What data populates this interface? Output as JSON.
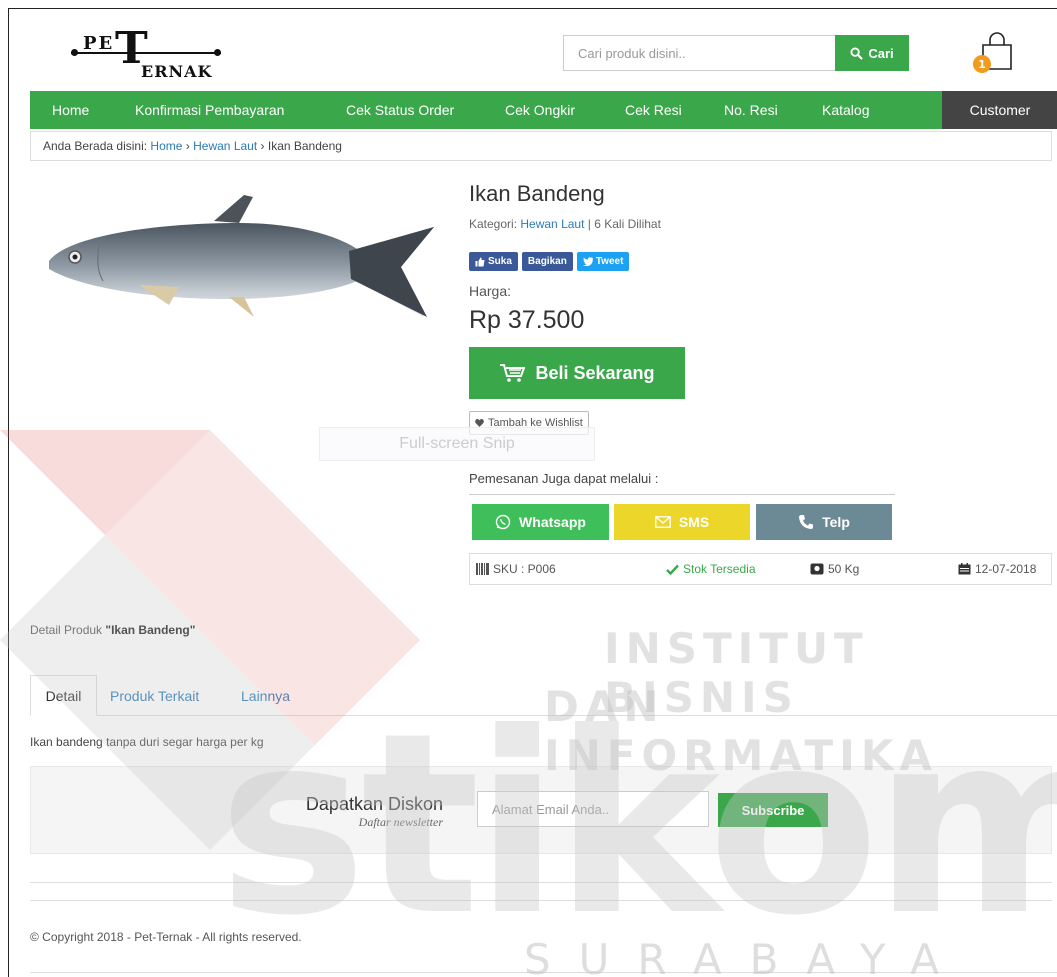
{
  "header": {
    "logo_top": "PE",
    "logo_bottom": "ERNAK",
    "search_placeholder": "Cari produk disini..",
    "search_button": "Cari",
    "cart_count": "1"
  },
  "nav": {
    "items": [
      "Home",
      "Konfirmasi Pembayaran",
      "Cek Status Order",
      "Cek Ongkir",
      "Cek Resi",
      "No. Resi",
      "Katalog"
    ],
    "customer": "Customer"
  },
  "breadcrumb": {
    "prefix": "Anda Berada disini:",
    "home": "Home",
    "sep1": "›",
    "category": "Hewan Laut",
    "sep2": "›",
    "current": "Ikan Bandeng"
  },
  "product": {
    "title": "Ikan Bandeng",
    "category_label": "Kategori:",
    "category": "Hewan Laut",
    "views": "| 6 Kali Dilihat",
    "social": {
      "like": "Suka",
      "share": "Bagikan",
      "tweet": "Tweet"
    },
    "price_label": "Harga:",
    "price": "Rp 37.500",
    "buy_label": "Beli Sekarang",
    "wishlist_label": "Tambah ke Wishlist",
    "snip_overlay": "Full-screen Snip",
    "order_via_label": "Pemesanan Juga dapat melalui :",
    "order_buttons": {
      "whatsapp": "Whatsapp",
      "sms": "SMS",
      "telp": "Telp"
    },
    "info": {
      "sku": "SKU : P006",
      "stock": "Stok Tersedia",
      "weight": "50 Kg",
      "date": "12-07-2018"
    }
  },
  "detail": {
    "title_prefix": "Detail Produk",
    "title_name": "\"Ikan Bandeng\"",
    "tabs": [
      "Detail",
      "Produk Terkait",
      "Lainnya"
    ],
    "description": "Ikan bandeng  tanpa duri segar harga per kg"
  },
  "newsletter": {
    "title": "Dapatkan Diskon",
    "subtitle": "Daftar newsletter",
    "email_placeholder": "Alamat Email Anda..",
    "button": "Subscribe"
  },
  "footer": {
    "copyright": "© Copyright 2018 - Pet-Ternak - All rights reserved."
  },
  "watermark": {
    "line1": "INSTITUT BISNIS",
    "line2": "DAN INFORMATIKA",
    "brand": "stikom",
    "city": "SURABAYA"
  },
  "colors": {
    "primary_green": "#3aa84a",
    "nav_dark": "#444444",
    "link_blue": "#2c7bb6",
    "whatsapp": "#3fbf5a",
    "sms": "#ecd62a",
    "telp": "#6b8a96",
    "facebook": "#3b5998",
    "twitter": "#1da1f2",
    "badge_orange": "#f29b1f"
  }
}
